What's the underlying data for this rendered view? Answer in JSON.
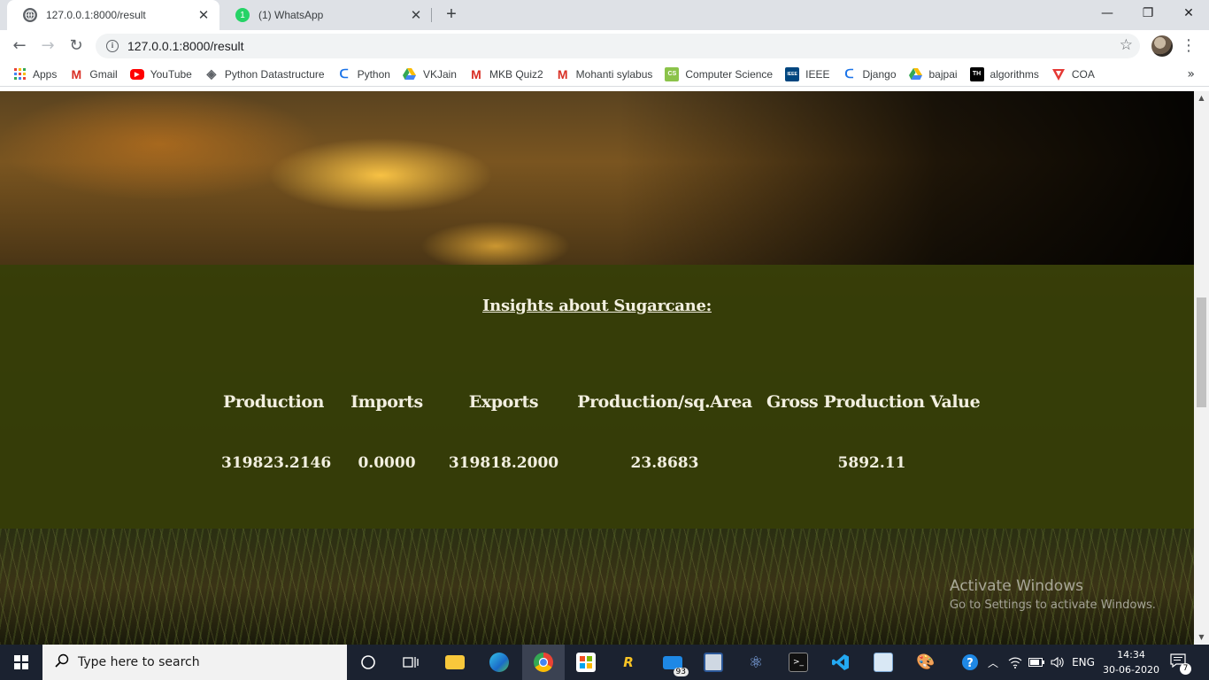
{
  "browser": {
    "tabs": [
      {
        "title": "127.0.0.1:8000/result",
        "active": true,
        "icon": "globe-icon"
      },
      {
        "title": "(1) WhatsApp",
        "active": false,
        "icon": "whatsapp-icon",
        "badge": "1"
      }
    ],
    "url": "127.0.0.1:8000/result",
    "bookmarks": [
      {
        "label": "Apps",
        "icon": "apps-grid-icon"
      },
      {
        "label": "Gmail",
        "icon": "gmail-icon"
      },
      {
        "label": "YouTube",
        "icon": "youtube-icon"
      },
      {
        "label": "Python Datastructure",
        "icon": "diamond-icon"
      },
      {
        "label": "Python",
        "icon": "python-icon"
      },
      {
        "label": "VKJain",
        "icon": "drive-icon"
      },
      {
        "label": "MKB Quiz2",
        "icon": "gmail-icon"
      },
      {
        "label": "Mohanti sylabus",
        "icon": "gmail-icon"
      },
      {
        "label": "Computer Science",
        "icon": "computer-science-icon"
      },
      {
        "label": "IEEE",
        "icon": "ieee-icon"
      },
      {
        "label": "Django",
        "icon": "django-icon"
      },
      {
        "label": "bajpai",
        "icon": "drive-icon"
      },
      {
        "label": "algorithms",
        "icon": "th-icon"
      },
      {
        "label": "COA",
        "icon": "coa-icon"
      }
    ],
    "bookmarks_more": "»"
  },
  "page": {
    "insights_title": "Insights about Sugarcane:",
    "stats": [
      {
        "label": "Production",
        "value": "319823.2146"
      },
      {
        "label": "Imports",
        "value": "0.0000"
      },
      {
        "label": "Exports",
        "value": "319818.2000"
      },
      {
        "label": "Production/sq.Area",
        "value": "23.8683"
      },
      {
        "label": "Gross Production Value",
        "value": "5892.11"
      }
    ],
    "watermark": {
      "line1": "Activate Windows",
      "line2": "Go to Settings to activate Windows."
    }
  },
  "taskbar": {
    "search_placeholder": "Type here to search",
    "mail_badge": "93",
    "language": "ENG",
    "time": "14:34",
    "date": "30-06-2020",
    "notification_count": "7"
  }
}
